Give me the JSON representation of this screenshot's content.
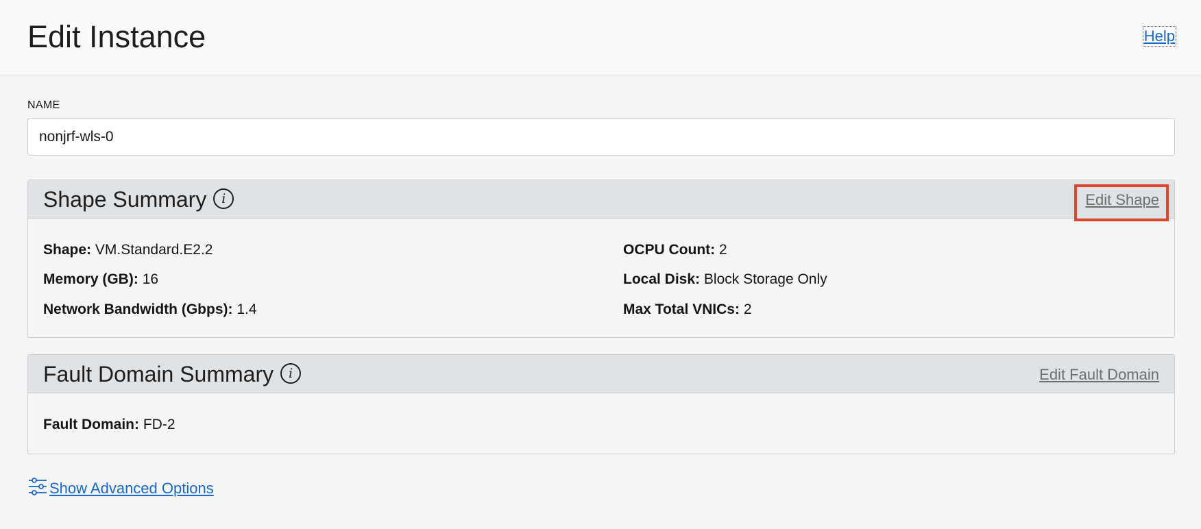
{
  "header": {
    "title": "Edit Instance",
    "help_label": "Help"
  },
  "name_field": {
    "label": "NAME",
    "value": "nonjrf-wls-0"
  },
  "shape_summary": {
    "title": "Shape Summary",
    "info_icon": "info-icon",
    "edit_label": "Edit Shape",
    "highlight_color": "#e0462c",
    "fields": {
      "shape_label": "Shape:",
      "shape_value": "VM.Standard.E2.2",
      "memory_label": "Memory (GB):",
      "memory_value": "16",
      "bandwidth_label": "Network Bandwidth (Gbps):",
      "bandwidth_value": "1.4",
      "ocpu_label": "OCPU Count:",
      "ocpu_value": "2",
      "disk_label": "Local Disk:",
      "disk_value": "Block Storage Only",
      "vnics_label": "Max Total VNICs:",
      "vnics_value": "2"
    }
  },
  "fault_domain_summary": {
    "title": "Fault Domain Summary",
    "info_icon": "info-icon",
    "edit_label": "Edit Fault Domain",
    "fault_domain_label": "Fault Domain:",
    "fault_domain_value": "FD-2"
  },
  "advanced": {
    "icon": "sliders-icon",
    "label": "Show Advanced Options"
  },
  "colors": {
    "link": "#1669c7",
    "panel_header": "#e0e3e6",
    "highlight": "#e0462c"
  }
}
